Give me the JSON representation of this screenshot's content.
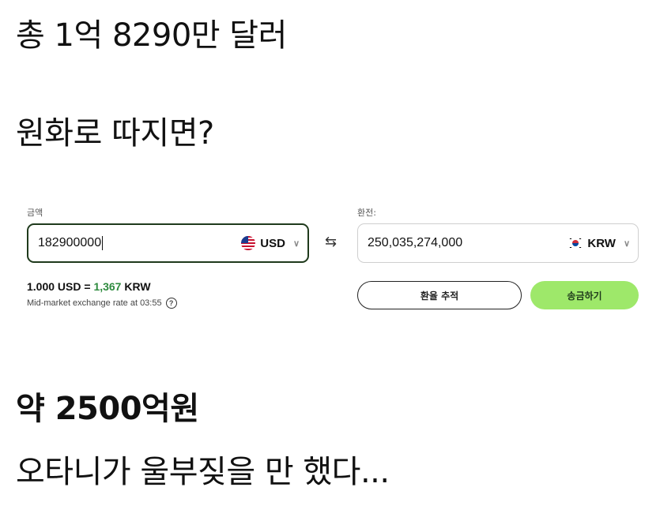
{
  "text": {
    "line1": "총 1억 8290만 달러",
    "line2": "원화로 따지면?",
    "line3": "약 2500억원",
    "line4": "오타니가 울부짖을 만 했다..."
  },
  "converter": {
    "amount_label": "금액",
    "amount_value": "182900000",
    "from_currency": "USD",
    "to_label": "환전:",
    "converted_value": "250,035,274,000",
    "to_currency": "KRW",
    "rate_prefix": "1.000 USD = ",
    "rate_value": "1,367",
    "rate_suffix": " KRW",
    "mid_market": "Mid-market exchange rate at 03:55",
    "track_button": "환율 추적",
    "send_button": "송금하기"
  },
  "icons": {
    "swap": "swap-arrows-icon",
    "chevron": "chevron-down-icon",
    "help": "question-circle-icon",
    "flag_us": "us-flag-icon",
    "flag_kr": "kr-flag-icon"
  },
  "colors": {
    "accent_green": "#9ee86a",
    "rate_green": "#2e8b3e",
    "active_border": "#1f3a1c"
  }
}
